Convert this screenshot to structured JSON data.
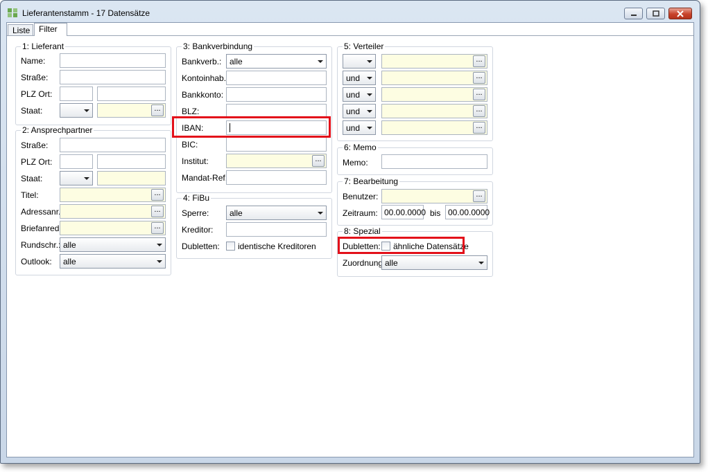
{
  "window": {
    "title": "Lieferantenstamm - 17 Datensätze",
    "icon": "supplier-app-icon",
    "controls": [
      "minimize-icon",
      "maximize-icon",
      "close-icon"
    ]
  },
  "tabs": [
    {
      "label": "Liste",
      "active": false
    },
    {
      "label": "Filter",
      "active": true
    }
  ],
  "groups": {
    "lieferant": {
      "title": "1: Lieferant",
      "name_label": "Name:",
      "strasse_label": "Straße:",
      "plz_label": "PLZ Ort:",
      "staat_label": "Staat:",
      "staat_value": ""
    },
    "ansprech": {
      "title": "2: Ansprechpartner",
      "strasse_label": "Straße:",
      "plz_label": "PLZ Ort:",
      "staat_label": "Staat:",
      "staat_value": "",
      "titel_label": "Titel:",
      "adressanr_label": "Adressanr.:",
      "briefanred_label": "Briefanred.:",
      "rundschr_label": "Rundschr.:",
      "rundschr_value": "alle",
      "outlook_label": "Outlook:",
      "outlook_value": "alle"
    },
    "bank": {
      "title": "3: Bankverbindung",
      "bankverb_label": "Bankverb.:",
      "bankverb_value": "alle",
      "kontoinhab_label": "Kontoinhab.:",
      "bankkonto_label": "Bankkonto:",
      "blz_label": "BLZ:",
      "iban_label": "IBAN:",
      "iban_value": "",
      "bic_label": "BIC:",
      "institut_label": "Institut:",
      "mandat_label": "Mandat-Ref.:"
    },
    "fibu": {
      "title": "4: FiBu",
      "sperre_label": "Sperre:",
      "sperre_value": "alle",
      "kreditor_label": "Kreditor:",
      "dubletten_label": "Dubletten:",
      "dubletten_checkbox_label": "identische Kreditoren",
      "dubletten_checked": false
    },
    "verteiler": {
      "title": "5: Verteiler",
      "rows": [
        {
          "op": ""
        },
        {
          "op": "und"
        },
        {
          "op": "und"
        },
        {
          "op": "und"
        },
        {
          "op": "und"
        }
      ]
    },
    "memo": {
      "title": "6: Memo",
      "memo_label": "Memo:"
    },
    "bearbeitung": {
      "title": "7: Bearbeitung",
      "benutzer_label": "Benutzer:",
      "zeitraum_label": "Zeitraum:",
      "zeitraum_from": "00.00.0000",
      "bis_label": "bis",
      "zeitraum_to": "00.00.0000"
    },
    "spezial": {
      "title": "8: Spezial",
      "dubletten_label": "Dubletten:",
      "dubletten_checkbox_label": "ähnliche Datensätze",
      "dubletten_checked": false,
      "zuordnung_label": "Zuordnung:",
      "zuordnung_value": "alle"
    }
  },
  "ellipsis_label": "...",
  "highlight_color": "#e3101a",
  "input_yellow": "#fdfde2"
}
